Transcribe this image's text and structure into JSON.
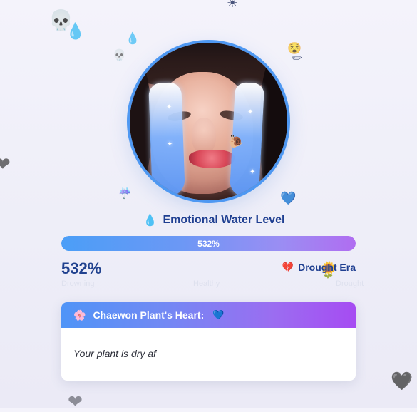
{
  "decorations": {
    "skull": "💀",
    "drop_1": "💧",
    "drop_2": "💧",
    "skull_small": "💀",
    "sun_top": "☀",
    "face_top": "😵",
    "pencil": "✏",
    "left_heart": "❤",
    "storm": "☔",
    "blue_heart": "💙",
    "sunflower": "🌻",
    "dark_heart": "🖤",
    "gray_heart": "❤"
  },
  "avatar": {
    "sparkle": "✦",
    "snail": "🐌"
  },
  "water_level": {
    "icon": "💧",
    "title": "Emotional Water Level",
    "progress_fraction": 1,
    "progress_label": "532%",
    "value_label": "532%",
    "status_icon": "💔",
    "status_label": "Drought Era"
  },
  "hint_labels": [
    "Drowning",
    "Healthy",
    "Drought"
  ],
  "plant_heart": {
    "header_icon": "🌸",
    "title": "Chaewon Plant's Heart:",
    "heart_icon": "💙",
    "message": "Your plant is dry af"
  },
  "colors": {
    "accent_blue": "#4e98f2",
    "accent_purple": "#a64cf2",
    "title_blue": "#1f3f91"
  }
}
